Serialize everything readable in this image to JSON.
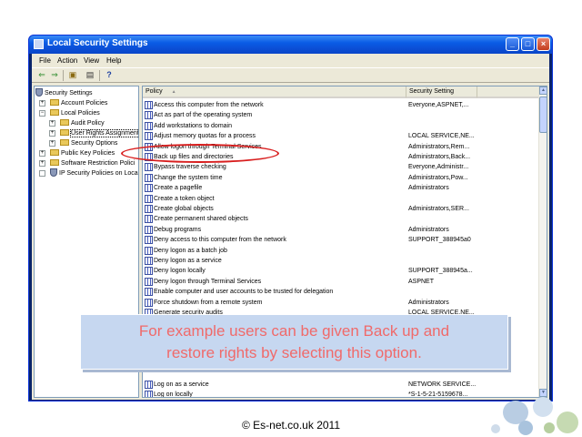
{
  "window": {
    "title": "Local Security Settings",
    "buttons": {
      "minimize": "_",
      "maximize": "□",
      "close": "×"
    }
  },
  "menu": [
    "File",
    "Action",
    "View",
    "Help"
  ],
  "toolbar": {
    "icons": [
      "back-arrow-icon",
      "forward-arrow-icon",
      "up-folder-icon",
      "export-list-icon",
      "help-icon"
    ],
    "glyphs": [
      "⇐",
      "⇒",
      "▣",
      "▤",
      "?"
    ]
  },
  "tree": {
    "items": [
      {
        "label": "Security Settings",
        "icon": "shield-icon",
        "expander": ""
      },
      {
        "label": "Account Policies",
        "icon": "folder-icon",
        "expander": "+"
      },
      {
        "label": "Local Policies",
        "icon": "folder-icon",
        "expander": "−"
      },
      {
        "label": "Audit Policy",
        "icon": "folder-icon",
        "expander": "+"
      },
      {
        "label": "User Rights Assignment",
        "icon": "folder-icon",
        "expander": "+"
      },
      {
        "label": "Security Options",
        "icon": "folder-icon",
        "expander": "+"
      },
      {
        "label": "Public Key Policies",
        "icon": "folder-icon",
        "expander": "+"
      },
      {
        "label": "Software Restriction Polici",
        "icon": "folder-icon",
        "expander": "+"
      },
      {
        "label": "IP Security Policies on Loca",
        "icon": "shield-icon",
        "expander": ""
      }
    ]
  },
  "list": {
    "columns": {
      "policy": "Policy",
      "setting": "Security Setting",
      "sort_glyph": "▲"
    },
    "rows": [
      {
        "policy": "Access this computer from the network",
        "setting": "Everyone,ASPNET,..."
      },
      {
        "policy": "Act as part of the operating system",
        "setting": ""
      },
      {
        "policy": "Add workstations to domain",
        "setting": ""
      },
      {
        "policy": "Adjust memory quotas for a process",
        "setting": "LOCAL SERVICE,NE..."
      },
      {
        "policy": "Allow logon through Terminal Services",
        "setting": "Administrators,Rem..."
      },
      {
        "policy": "Back up files and directories",
        "setting": "Administrators,Back..."
      },
      {
        "policy": "Bypass traverse checking",
        "setting": "Everyone,Administr..."
      },
      {
        "policy": "Change the system time",
        "setting": "Administrators,Pow..."
      },
      {
        "policy": "Create a pagefile",
        "setting": "Administrators"
      },
      {
        "policy": "Create a token object",
        "setting": ""
      },
      {
        "policy": "Create global objects",
        "setting": "Administrators,SER..."
      },
      {
        "policy": "Create permanent shared objects",
        "setting": ""
      },
      {
        "policy": "Debug programs",
        "setting": "Administrators"
      },
      {
        "policy": "Deny access to this computer from the network",
        "setting": "SUPPORT_388945a0"
      },
      {
        "policy": "Deny logon as a batch job",
        "setting": ""
      },
      {
        "policy": "Deny logon as a service",
        "setting": ""
      },
      {
        "policy": "Deny logon locally",
        "setting": "SUPPORT_388945a..."
      },
      {
        "policy": "Deny logon through Terminal Services",
        "setting": "ASPNET"
      },
      {
        "policy": "Enable computer and user accounts to be trusted for delegation",
        "setting": ""
      },
      {
        "policy": "Force shutdown from a remote system",
        "setting": "Administrators"
      },
      {
        "policy": "Generate security audits",
        "setting": "LOCAL SERVICE,NE..."
      }
    ],
    "bottom_rows": [
      {
        "policy": "Log on as a service",
        "setting": "NETWORK SERVICE..."
      },
      {
        "policy": "Log on locally",
        "setting": "*S-1-5-21-5159678..."
      }
    ]
  },
  "caption": {
    "line1": "For example users can be given Back up and",
    "line2": "restore rights by selecting this option."
  },
  "footer": "© Es-net.co.uk 2011",
  "colors": {
    "titlebar": "#0a5ce5",
    "highlight_ellipse": "#d81e1e",
    "caption_text": "#f06a6a",
    "caption_bg": "#c6d7f0"
  }
}
